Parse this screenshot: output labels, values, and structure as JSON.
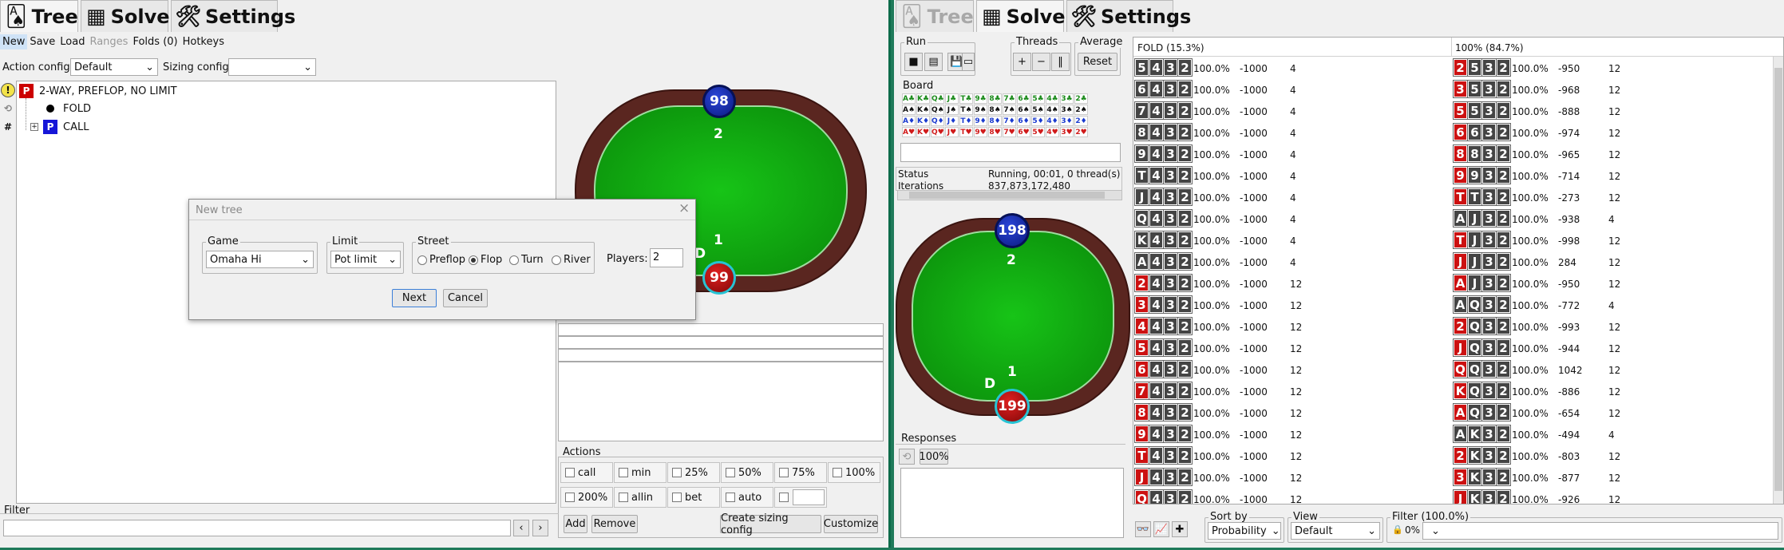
{
  "left": {
    "tabs": [
      {
        "label": "Tree",
        "icon": "playing-cards-icon"
      },
      {
        "label": "Solve",
        "icon": "calculator-icon"
      },
      {
        "label": "Settings",
        "icon": "wrench-screwdriver-icon"
      }
    ],
    "menu": {
      "new": "New",
      "save": "Save",
      "load": "Load",
      "ranges": "Ranges",
      "folds": "Folds (0)",
      "hotkeys": "Hotkeys"
    },
    "action_config_label": "Action config:",
    "action_config_value": "Default",
    "sizing_config_label": "Sizing config:",
    "sizing_config_value": "",
    "tree": {
      "root_badge": "P",
      "root": "2-WAY, PREFLOP, NO LIMIT",
      "fold": "FOLD",
      "call_badge": "P",
      "call": "CALL"
    },
    "side_icons": [
      "!",
      "⟲",
      "#"
    ],
    "table": {
      "top_stack": "98",
      "top_seat": "2",
      "bottom_seat": "1",
      "bottom_stack": "99",
      "dealer": "D"
    },
    "filter_label": "Filter",
    "filter_value": "",
    "actions": {
      "label": "Actions",
      "row1": [
        "call",
        "min",
        "25%",
        "50%",
        "75%",
        "100%"
      ],
      "row2": [
        "200%",
        "allin",
        "bet",
        "auto",
        ""
      ],
      "add": "Add",
      "remove": "Remove",
      "create": "Create sizing config",
      "customize": "Customize"
    }
  },
  "dialog": {
    "title": "New tree",
    "game_label": "Game",
    "game_value": "Omaha Hi",
    "limit_label": "Limit",
    "limit_value": "Pot limit",
    "street_label": "Street",
    "streets": [
      "Preflop",
      "Flop",
      "Turn",
      "River"
    ],
    "selected_street": "Flop",
    "players_label": "Players:",
    "players_value": "2",
    "next": "Next",
    "cancel": "Cancel"
  },
  "right": {
    "tabs": [
      {
        "label": "Tree",
        "icon": "playing-cards-icon"
      },
      {
        "label": "Solve",
        "icon": "calculator-icon"
      },
      {
        "label": "Settings",
        "icon": "wrench-screwdriver-icon"
      }
    ],
    "run_label": "Run",
    "threads_label": "Threads",
    "average_label": "Average",
    "reset": "Reset",
    "board_label": "Board",
    "board_rows": [
      {
        "suit": "♣",
        "color": "#1a8a1a",
        "cards": [
          "A♣",
          "K♣",
          "Q♣",
          "J♣",
          "T♣",
          "9♣",
          "8♣",
          "7♣",
          "6♣",
          "5♣",
          "4♣",
          "3♣",
          "2♣"
        ]
      },
      {
        "suit": "♠",
        "color": "#111111",
        "cards": [
          "A♠",
          "K♠",
          "Q♠",
          "J♠",
          "T♠",
          "9♠",
          "8♠",
          "7♠",
          "6♠",
          "5♠",
          "4♠",
          "3♠",
          "2♠"
        ]
      },
      {
        "suit": "♦",
        "color": "#1a3ad0",
        "cards": [
          "A♦",
          "K♦",
          "Q♦",
          "J♦",
          "T♦",
          "9♦",
          "8♦",
          "7♦",
          "6♦",
          "5♦",
          "4♦",
          "3♦",
          "2♦"
        ]
      },
      {
        "suit": "♥",
        "color": "#d01a1a",
        "cards": [
          "A♥",
          "K♥",
          "Q♥",
          "J♥",
          "T♥",
          "9♥",
          "8♥",
          "7♥",
          "6♥",
          "5♥",
          "4♥",
          "3♥",
          "2♥"
        ]
      }
    ],
    "status_label": "Status",
    "status_value": "Running, 00:01, 0 thread(s)",
    "iterations_label": "Iterations",
    "iterations_value": "837,873,172,480",
    "table": {
      "top_stack": "198",
      "top_seat": "2",
      "bottom_seat": "1",
      "bottom_stack": "199",
      "dealer": "D"
    },
    "responses_label": "Responses",
    "responses_pct": "100%",
    "fold_header": "FOLD (15.3%)",
    "call_header": "100% (84.7%)",
    "fold_rows": [
      {
        "cards": [
          "5",
          "4",
          "3",
          "2"
        ],
        "red": [],
        "pct": "100.0%",
        "ev": "-1000",
        "n": "4"
      },
      {
        "cards": [
          "6",
          "4",
          "3",
          "2"
        ],
        "red": [],
        "pct": "100.0%",
        "ev": "-1000",
        "n": "4"
      },
      {
        "cards": [
          "7",
          "4",
          "3",
          "2"
        ],
        "red": [],
        "pct": "100.0%",
        "ev": "-1000",
        "n": "4"
      },
      {
        "cards": [
          "8",
          "4",
          "3",
          "2"
        ],
        "red": [],
        "pct": "100.0%",
        "ev": "-1000",
        "n": "4"
      },
      {
        "cards": [
          "9",
          "4",
          "3",
          "2"
        ],
        "red": [],
        "pct": "100.0%",
        "ev": "-1000",
        "n": "4"
      },
      {
        "cards": [
          "T",
          "4",
          "3",
          "2"
        ],
        "red": [],
        "pct": "100.0%",
        "ev": "-1000",
        "n": "4"
      },
      {
        "cards": [
          "J",
          "4",
          "3",
          "2"
        ],
        "red": [],
        "pct": "100.0%",
        "ev": "-1000",
        "n": "4"
      },
      {
        "cards": [
          "Q",
          "4",
          "3",
          "2"
        ],
        "red": [],
        "pct": "100.0%",
        "ev": "-1000",
        "n": "4"
      },
      {
        "cards": [
          "K",
          "4",
          "3",
          "2"
        ],
        "red": [],
        "pct": "100.0%",
        "ev": "-1000",
        "n": "4"
      },
      {
        "cards": [
          "A",
          "4",
          "3",
          "2"
        ],
        "red": [],
        "pct": "100.0%",
        "ev": "-1000",
        "n": "4"
      },
      {
        "cards": [
          "2",
          "4",
          "3",
          "2"
        ],
        "red": [
          0
        ],
        "pct": "100.0%",
        "ev": "-1000",
        "n": "12"
      },
      {
        "cards": [
          "3",
          "4",
          "3",
          "2"
        ],
        "red": [
          0
        ],
        "pct": "100.0%",
        "ev": "-1000",
        "n": "12"
      },
      {
        "cards": [
          "4",
          "4",
          "3",
          "2"
        ],
        "red": [
          0
        ],
        "pct": "100.0%",
        "ev": "-1000",
        "n": "12"
      },
      {
        "cards": [
          "5",
          "4",
          "3",
          "2"
        ],
        "red": [
          0
        ],
        "pct": "100.0%",
        "ev": "-1000",
        "n": "12"
      },
      {
        "cards": [
          "6",
          "4",
          "3",
          "2"
        ],
        "red": [
          0
        ],
        "pct": "100.0%",
        "ev": "-1000",
        "n": "12"
      },
      {
        "cards": [
          "7",
          "4",
          "3",
          "2"
        ],
        "red": [
          0
        ],
        "pct": "100.0%",
        "ev": "-1000",
        "n": "12"
      },
      {
        "cards": [
          "8",
          "4",
          "3",
          "2"
        ],
        "red": [
          0
        ],
        "pct": "100.0%",
        "ev": "-1000",
        "n": "12"
      },
      {
        "cards": [
          "9",
          "4",
          "3",
          "2"
        ],
        "red": [
          0
        ],
        "pct": "100.0%",
        "ev": "-1000",
        "n": "12"
      },
      {
        "cards": [
          "T",
          "4",
          "3",
          "2"
        ],
        "red": [
          0
        ],
        "pct": "100.0%",
        "ev": "-1000",
        "n": "12"
      },
      {
        "cards": [
          "J",
          "4",
          "3",
          "2"
        ],
        "red": [
          0
        ],
        "pct": "100.0%",
        "ev": "-1000",
        "n": "12"
      },
      {
        "cards": [
          "Q",
          "4",
          "3",
          "2"
        ],
        "red": [
          0
        ],
        "pct": "100.0%",
        "ev": "-1000",
        "n": "12"
      }
    ],
    "call_rows": [
      {
        "cards": [
          "2",
          "5",
          "3",
          "2"
        ],
        "red": [
          0
        ],
        "pct": "100.0%",
        "ev": "-950",
        "n": "12"
      },
      {
        "cards": [
          "3",
          "5",
          "3",
          "2"
        ],
        "red": [
          0
        ],
        "pct": "100.0%",
        "ev": "-968",
        "n": "12"
      },
      {
        "cards": [
          "5",
          "5",
          "3",
          "2"
        ],
        "red": [
          0
        ],
        "pct": "100.0%",
        "ev": "-888",
        "n": "12"
      },
      {
        "cards": [
          "6",
          "6",
          "3",
          "2"
        ],
        "red": [
          0
        ],
        "pct": "100.0%",
        "ev": "-974",
        "n": "12"
      },
      {
        "cards": [
          "8",
          "8",
          "3",
          "2"
        ],
        "red": [
          0
        ],
        "pct": "100.0%",
        "ev": "-965",
        "n": "12"
      },
      {
        "cards": [
          "9",
          "9",
          "3",
          "2"
        ],
        "red": [
          0
        ],
        "pct": "100.0%",
        "ev": "-714",
        "n": "12"
      },
      {
        "cards": [
          "T",
          "T",
          "3",
          "2"
        ],
        "red": [
          0
        ],
        "pct": "100.0%",
        "ev": "-273",
        "n": "12"
      },
      {
        "cards": [
          "A",
          "J",
          "3",
          "2"
        ],
        "red": [],
        "pct": "100.0%",
        "ev": "-938",
        "n": "4"
      },
      {
        "cards": [
          "T",
          "J",
          "3",
          "2"
        ],
        "red": [
          0
        ],
        "pct": "100.0%",
        "ev": "-998",
        "n": "12"
      },
      {
        "cards": [
          "J",
          "J",
          "3",
          "2"
        ],
        "red": [
          0
        ],
        "pct": "100.0%",
        "ev": "284",
        "n": "12"
      },
      {
        "cards": [
          "A",
          "J",
          "3",
          "2"
        ],
        "red": [
          0
        ],
        "pct": "100.0%",
        "ev": "-950",
        "n": "12"
      },
      {
        "cards": [
          "A",
          "Q",
          "3",
          "2"
        ],
        "red": [],
        "pct": "100.0%",
        "ev": "-772",
        "n": "4"
      },
      {
        "cards": [
          "2",
          "Q",
          "3",
          "2"
        ],
        "red": [
          0
        ],
        "pct": "100.0%",
        "ev": "-993",
        "n": "12"
      },
      {
        "cards": [
          "J",
          "Q",
          "3",
          "2"
        ],
        "red": [
          0
        ],
        "pct": "100.0%",
        "ev": "-944",
        "n": "12"
      },
      {
        "cards": [
          "Q",
          "Q",
          "3",
          "2"
        ],
        "red": [
          0
        ],
        "pct": "100.0%",
        "ev": "1042",
        "n": "12"
      },
      {
        "cards": [
          "K",
          "Q",
          "3",
          "2"
        ],
        "red": [
          0
        ],
        "pct": "100.0%",
        "ev": "-886",
        "n": "12"
      },
      {
        "cards": [
          "A",
          "Q",
          "3",
          "2"
        ],
        "red": [
          0
        ],
        "pct": "100.0%",
        "ev": "-654",
        "n": "12"
      },
      {
        "cards": [
          "A",
          "K",
          "3",
          "2"
        ],
        "red": [],
        "pct": "100.0%",
        "ev": "-494",
        "n": "4"
      },
      {
        "cards": [
          "2",
          "K",
          "3",
          "2"
        ],
        "red": [
          0
        ],
        "pct": "100.0%",
        "ev": "-803",
        "n": "12"
      },
      {
        "cards": [
          "3",
          "K",
          "3",
          "2"
        ],
        "red": [
          0
        ],
        "pct": "100.0%",
        "ev": "-877",
        "n": "12"
      },
      {
        "cards": [
          "J",
          "K",
          "3",
          "2"
        ],
        "red": [
          0
        ],
        "pct": "100.0%",
        "ev": "-926",
        "n": "12"
      }
    ],
    "sort_label": "Sort by",
    "sort_value": "Probability",
    "view_label": "View",
    "view_value": "Default",
    "filter_label": "Filter (100.0%)",
    "filter_pct": "0%"
  }
}
